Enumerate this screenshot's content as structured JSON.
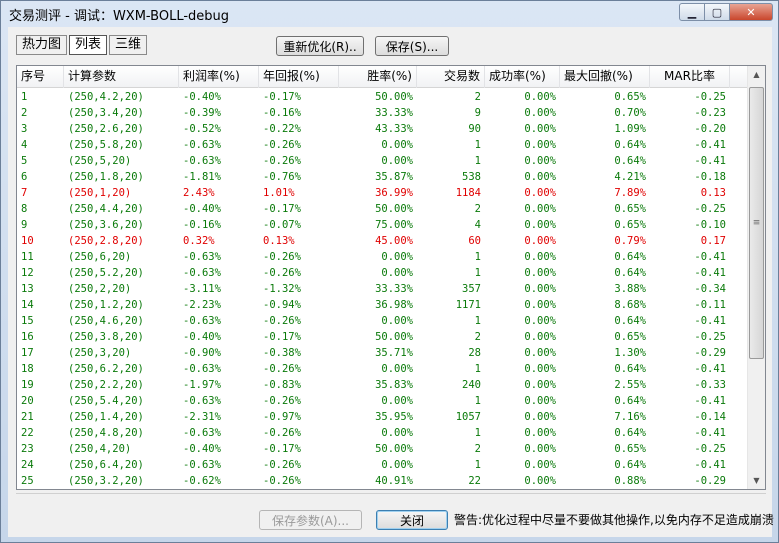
{
  "window": {
    "title": "交易测评 - 调试：WXM-BOLL-debug",
    "minimize_glyph": "▁",
    "maximize_glyph": "▢",
    "close_glyph": "✕"
  },
  "view_tabs": [
    "热力图",
    "列表",
    "三维"
  ],
  "active_tab": 1,
  "toolbar": {
    "reoptimize_label": "重新优化(R)..",
    "save_label": "保存(S)..."
  },
  "table": {
    "columns": [
      "序号",
      "计算参数",
      "利润率(%)",
      "年回报(%)",
      "胜率(%)",
      "交易数",
      "成功率(%)",
      "最大回撤(%)",
      "MAR比率"
    ],
    "rows": [
      {
        "c": [
          "1",
          "(250,4.2,20)",
          "-0.40%",
          "-0.17%",
          "50.00%",
          "2",
          "0.00%",
          "0.65%",
          "-0.25"
        ],
        "hl": false
      },
      {
        "c": [
          "2",
          "(250,3.4,20)",
          "-0.39%",
          "-0.16%",
          "33.33%",
          "9",
          "0.00%",
          "0.70%",
          "-0.23"
        ],
        "hl": false
      },
      {
        "c": [
          "3",
          "(250,2.6,20)",
          "-0.52%",
          "-0.22%",
          "43.33%",
          "90",
          "0.00%",
          "1.09%",
          "-0.20"
        ],
        "hl": false
      },
      {
        "c": [
          "4",
          "(250,5.8,20)",
          "-0.63%",
          "-0.26%",
          "0.00%",
          "1",
          "0.00%",
          "0.64%",
          "-0.41"
        ],
        "hl": false
      },
      {
        "c": [
          "5",
          "(250,5,20)",
          "-0.63%",
          "-0.26%",
          "0.00%",
          "1",
          "0.00%",
          "0.64%",
          "-0.41"
        ],
        "hl": false
      },
      {
        "c": [
          "6",
          "(250,1.8,20)",
          "-1.81%",
          "-0.76%",
          "35.87%",
          "538",
          "0.00%",
          "4.21%",
          "-0.18"
        ],
        "hl": false
      },
      {
        "c": [
          "7",
          "(250,1,20)",
          "2.43%",
          "1.01%",
          "36.99%",
          "1184",
          "0.00%",
          "7.89%",
          "0.13"
        ],
        "hl": true
      },
      {
        "c": [
          "8",
          "(250,4.4,20)",
          "-0.40%",
          "-0.17%",
          "50.00%",
          "2",
          "0.00%",
          "0.65%",
          "-0.25"
        ],
        "hl": false
      },
      {
        "c": [
          "9",
          "(250,3.6,20)",
          "-0.16%",
          "-0.07%",
          "75.00%",
          "4",
          "0.00%",
          "0.65%",
          "-0.10"
        ],
        "hl": false
      },
      {
        "c": [
          "10",
          "(250,2.8,20)",
          "0.32%",
          "0.13%",
          "45.00%",
          "60",
          "0.00%",
          "0.79%",
          "0.17"
        ],
        "hl": true
      },
      {
        "c": [
          "11",
          "(250,6,20)",
          "-0.63%",
          "-0.26%",
          "0.00%",
          "1",
          "0.00%",
          "0.64%",
          "-0.41"
        ],
        "hl": false
      },
      {
        "c": [
          "12",
          "(250,5.2,20)",
          "-0.63%",
          "-0.26%",
          "0.00%",
          "1",
          "0.00%",
          "0.64%",
          "-0.41"
        ],
        "hl": false
      },
      {
        "c": [
          "13",
          "(250,2,20)",
          "-3.11%",
          "-1.32%",
          "33.33%",
          "357",
          "0.00%",
          "3.88%",
          "-0.34"
        ],
        "hl": false
      },
      {
        "c": [
          "14",
          "(250,1.2,20)",
          "-2.23%",
          "-0.94%",
          "36.98%",
          "1171",
          "0.00%",
          "8.68%",
          "-0.11"
        ],
        "hl": false
      },
      {
        "c": [
          "15",
          "(250,4.6,20)",
          "-0.63%",
          "-0.26%",
          "0.00%",
          "1",
          "0.00%",
          "0.64%",
          "-0.41"
        ],
        "hl": false
      },
      {
        "c": [
          "16",
          "(250,3.8,20)",
          "-0.40%",
          "-0.17%",
          "50.00%",
          "2",
          "0.00%",
          "0.65%",
          "-0.25"
        ],
        "hl": false
      },
      {
        "c": [
          "17",
          "(250,3,20)",
          "-0.90%",
          "-0.38%",
          "35.71%",
          "28",
          "0.00%",
          "1.30%",
          "-0.29"
        ],
        "hl": false
      },
      {
        "c": [
          "18",
          "(250,6.2,20)",
          "-0.63%",
          "-0.26%",
          "0.00%",
          "1",
          "0.00%",
          "0.64%",
          "-0.41"
        ],
        "hl": false
      },
      {
        "c": [
          "19",
          "(250,2.2,20)",
          "-1.97%",
          "-0.83%",
          "35.83%",
          "240",
          "0.00%",
          "2.55%",
          "-0.33"
        ],
        "hl": false
      },
      {
        "c": [
          "20",
          "(250,5.4,20)",
          "-0.63%",
          "-0.26%",
          "0.00%",
          "1",
          "0.00%",
          "0.64%",
          "-0.41"
        ],
        "hl": false
      },
      {
        "c": [
          "21",
          "(250,1.4,20)",
          "-2.31%",
          "-0.97%",
          "35.95%",
          "1057",
          "0.00%",
          "7.16%",
          "-0.14"
        ],
        "hl": false
      },
      {
        "c": [
          "22",
          "(250,4.8,20)",
          "-0.63%",
          "-0.26%",
          "0.00%",
          "1",
          "0.00%",
          "0.64%",
          "-0.41"
        ],
        "hl": false
      },
      {
        "c": [
          "23",
          "(250,4,20)",
          "-0.40%",
          "-0.17%",
          "50.00%",
          "2",
          "0.00%",
          "0.65%",
          "-0.25"
        ],
        "hl": false
      },
      {
        "c": [
          "24",
          "(250,6.4,20)",
          "-0.63%",
          "-0.26%",
          "0.00%",
          "1",
          "0.00%",
          "0.64%",
          "-0.41"
        ],
        "hl": false
      },
      {
        "c": [
          "25",
          "(250,3.2,20)",
          "-0.62%",
          "-0.26%",
          "40.91%",
          "22",
          "0.00%",
          "0.88%",
          "-0.29"
        ],
        "hl": false
      }
    ]
  },
  "colors": {
    "normal_row": "#0a7a0a",
    "highlight_row": "#e00000"
  },
  "footer": {
    "save_params_label": "保存参数(A)...",
    "close_label": "关闭",
    "warning": "警告:优化过程中尽量不要做其他操作,以免内存不足造成崩溃"
  },
  "scrollbar": {
    "up_glyph": "▲",
    "down_glyph": "▼",
    "thumb_glyph": "≡"
  }
}
